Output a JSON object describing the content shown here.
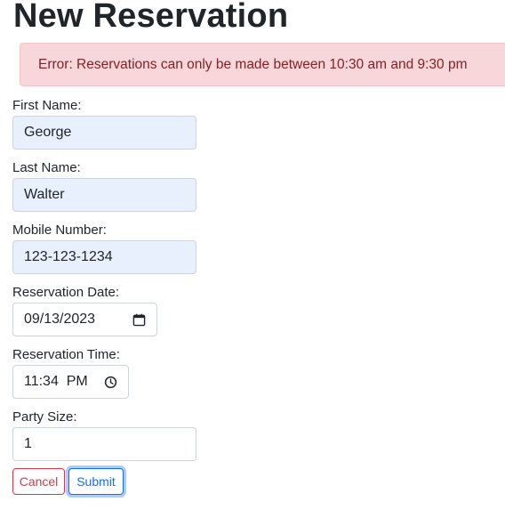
{
  "page": {
    "title": "New Reservation"
  },
  "alert": {
    "message": "Error: Reservations can only be made between 10:30 am and 9:30 pm",
    "type": "danger"
  },
  "form": {
    "first_name": {
      "label": "First Name:",
      "value": "George"
    },
    "last_name": {
      "label": "Last Name:",
      "value": "Walter"
    },
    "mobile_number": {
      "label": "Mobile Number:",
      "value": "123-123-1234"
    },
    "reservation_date": {
      "label": "Reservation Date:",
      "value": "09/13/2023",
      "icon": "calendar-icon"
    },
    "reservation_time": {
      "label": "Reservation Time:",
      "value": "11:34  PM",
      "icon": "clock-icon"
    },
    "party_size": {
      "label": "Party Size:",
      "value": "1"
    }
  },
  "actions": {
    "cancel_label": "Cancel",
    "submit_label": "Submit"
  },
  "colors": {
    "alert_background": "#f8d7da",
    "alert_text": "#842029",
    "autofill_background": "#e8f0fe",
    "cancel": "#dc3545",
    "submit": "#0d6efd"
  }
}
